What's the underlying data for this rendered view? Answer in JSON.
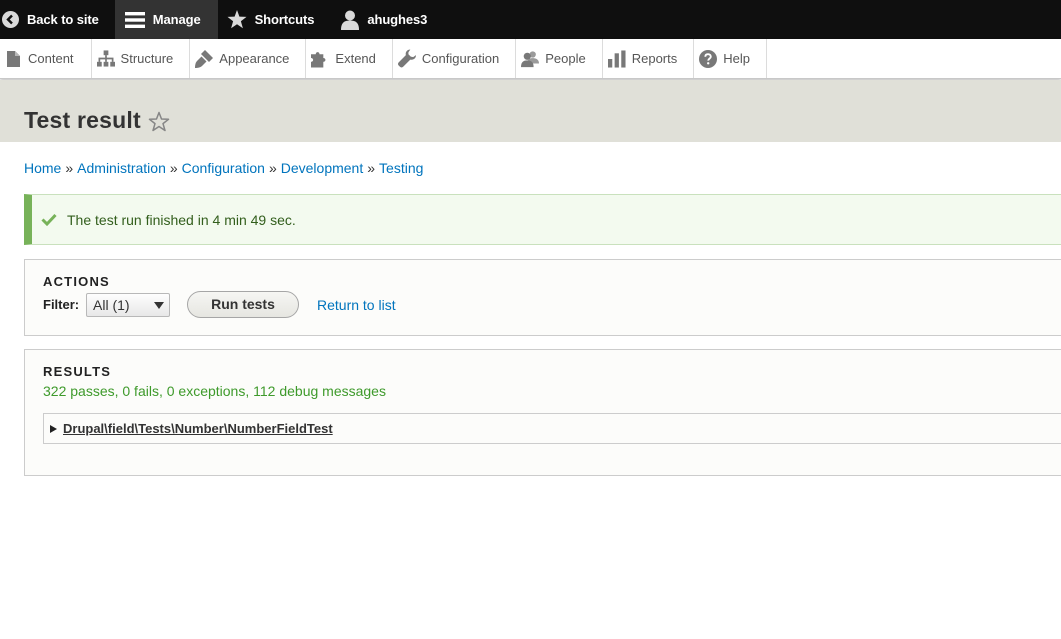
{
  "toolbar": {
    "back_label": "Back to site",
    "manage_label": "Manage",
    "shortcuts_label": "Shortcuts",
    "user_label": "ahughes3"
  },
  "tray": {
    "items": [
      {
        "label": "Content",
        "icon": "file-icon"
      },
      {
        "label": "Structure",
        "icon": "sitemap-icon"
      },
      {
        "label": "Appearance",
        "icon": "paintbrush-icon"
      },
      {
        "label": "Extend",
        "icon": "puzzle-icon"
      },
      {
        "label": "Configuration",
        "icon": "wrench-icon"
      },
      {
        "label": "People",
        "icon": "people-icon"
      },
      {
        "label": "Reports",
        "icon": "bar-chart-icon"
      },
      {
        "label": "Help",
        "icon": "help-icon"
      }
    ]
  },
  "page": {
    "title": "Test result"
  },
  "breadcrumb": {
    "items": [
      "Home",
      "Administration",
      "Configuration",
      "Development",
      "Testing"
    ],
    "separator": "»"
  },
  "status": {
    "message": "The test run finished in 4 min 49 sec."
  },
  "actions": {
    "legend": "ACTIONS",
    "filter_label": "Filter:",
    "filter_value": "All (1)",
    "run_button": "Run tests",
    "return_link": "Return to list"
  },
  "results": {
    "legend": "RESULTS",
    "summary": "322 passes, 0 fails, 0 exceptions, 112 debug messages",
    "tests": [
      {
        "name": "Drupal\\field\\Tests\\Number\\NumberFieldTest"
      }
    ]
  },
  "colors": {
    "link": "#0074bd",
    "success": "#77b259",
    "summary_text": "#3e9a2b"
  }
}
